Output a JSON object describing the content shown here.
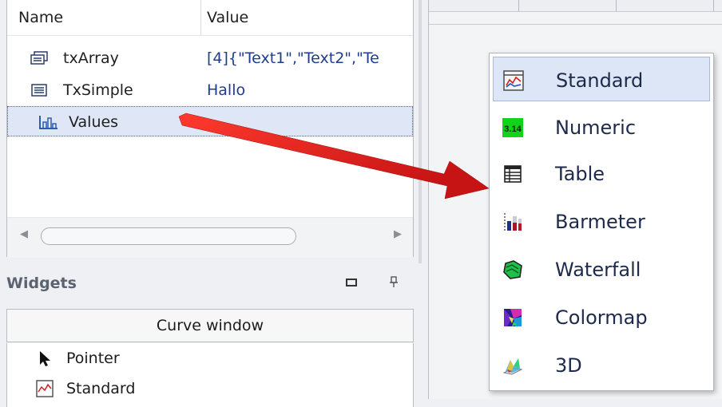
{
  "variables": {
    "columns": {
      "name": "Name",
      "value": "Value"
    },
    "rows": [
      {
        "name": "txArray",
        "value": "[4]{\"Text1\",\"Text2\",\"Te",
        "icon": "text-array-icon"
      },
      {
        "name": "TxSimple",
        "value": "Hallo",
        "icon": "text-variable-icon"
      },
      {
        "name": "Values",
        "value": "",
        "icon": "values-chart-icon"
      }
    ]
  },
  "widgets": {
    "title": "Widgets",
    "category_button": "Curve window",
    "items": [
      {
        "label": "Pointer",
        "icon": "pointer-arrow-icon"
      },
      {
        "label": "Standard",
        "icon": "standard-curve-icon"
      }
    ]
  },
  "context_menu": {
    "items": [
      {
        "label": "Standard",
        "icon": "standard-curve-icon",
        "highlighted": true
      },
      {
        "label": "Numeric",
        "icon": "numeric-display-icon"
      },
      {
        "label": "Table",
        "icon": "table-icon"
      },
      {
        "label": "Barmeter",
        "icon": "barmeter-icon"
      },
      {
        "label": "Waterfall",
        "icon": "waterfall-icon"
      },
      {
        "label": "Colormap",
        "icon": "colormap-icon"
      },
      {
        "label": "3D",
        "icon": "3d-plot-icon"
      }
    ]
  },
  "numeric_icon_text": "3.14",
  "colors": {
    "selection": "#dfe7f6",
    "menu_highlight": "#dde6f7",
    "arrow": "#e02020"
  }
}
